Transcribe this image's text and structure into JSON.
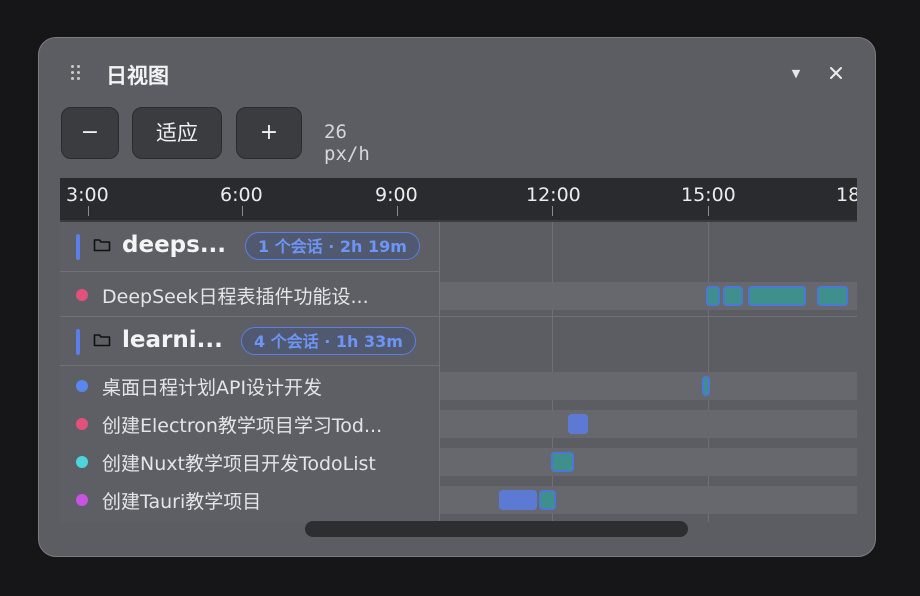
{
  "window": {
    "title": "日视图"
  },
  "toolbar": {
    "zoom_out_label": "−",
    "fit_label": "适应",
    "zoom_in_label": "+",
    "zoom_readout": "26 px/h"
  },
  "ruler": {
    "labels": [
      "3:00",
      "6:00",
      "9:00",
      "12:00",
      "15:00",
      "18"
    ]
  },
  "projects": [
    {
      "name": "deeps...",
      "badge": "1 个会话 · 2h 19m",
      "color": "#5b7fe8",
      "sessions": [
        {
          "label": "DeepSeek日程表插件功能设...",
          "dot_color": "#e0527a"
        }
      ]
    },
    {
      "name": "learni...",
      "badge": "4 个会话 · 1h 33m",
      "color": "#5b7fe8",
      "sessions": [
        {
          "label": "桌面日程计划API设计开发",
          "dot_color": "#5b86f0"
        },
        {
          "label": "创建Electron教学项目学习Tod...",
          "dot_color": "#e0527a"
        },
        {
          "label": "创建Nuxt教学项目开发TodoList",
          "dot_color": "#4fd3dc"
        },
        {
          "label": "创建Tauri教学项目",
          "dot_color": "#c654e0"
        }
      ]
    }
  ],
  "colors": {
    "accent": "#5b7fe8",
    "activity": "#3f8f8c",
    "window_bg": "#5b5d62"
  }
}
